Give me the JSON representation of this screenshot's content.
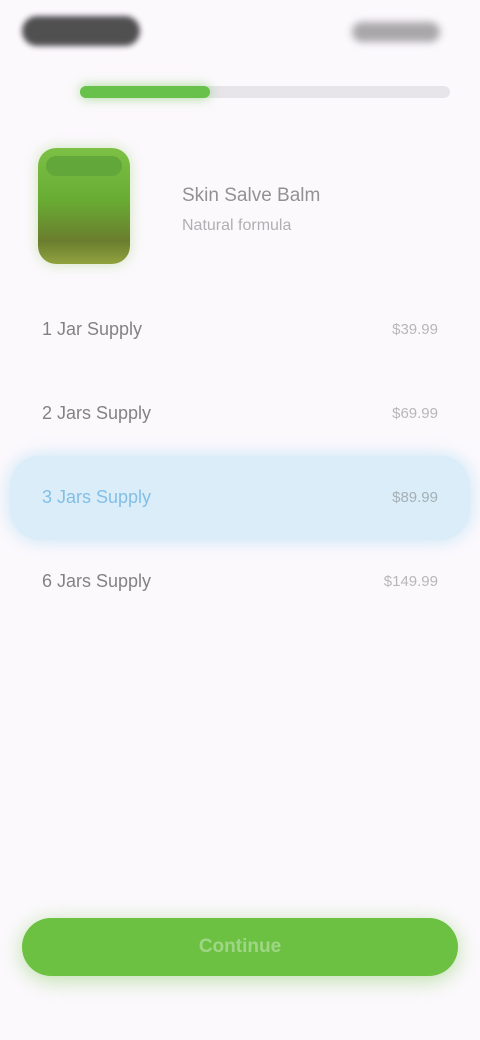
{
  "status_bar": {
    "time": "",
    "indicators": ""
  },
  "progress": {
    "fraction": 0.35,
    "color": "#67c14a"
  },
  "product": {
    "title": "Skin Salve Balm",
    "subtitle": "Natural formula",
    "image_icon": "product-jar-icon"
  },
  "options": [
    {
      "label": "1 Jar Supply",
      "price": "$39.99",
      "selected": false
    },
    {
      "label": "2 Jars Supply",
      "price": "$69.99",
      "selected": false
    },
    {
      "label": "3 Jars Supply",
      "price": "$89.99",
      "selected": true
    },
    {
      "label": "6 Jars Supply",
      "price": "$149.99",
      "selected": false
    }
  ],
  "cta": {
    "label": "Continue",
    "color": "#6cc143"
  },
  "colors": {
    "accent": "#6cc143",
    "selected_bg": "#daedf9",
    "background": "#fcf9fd"
  }
}
